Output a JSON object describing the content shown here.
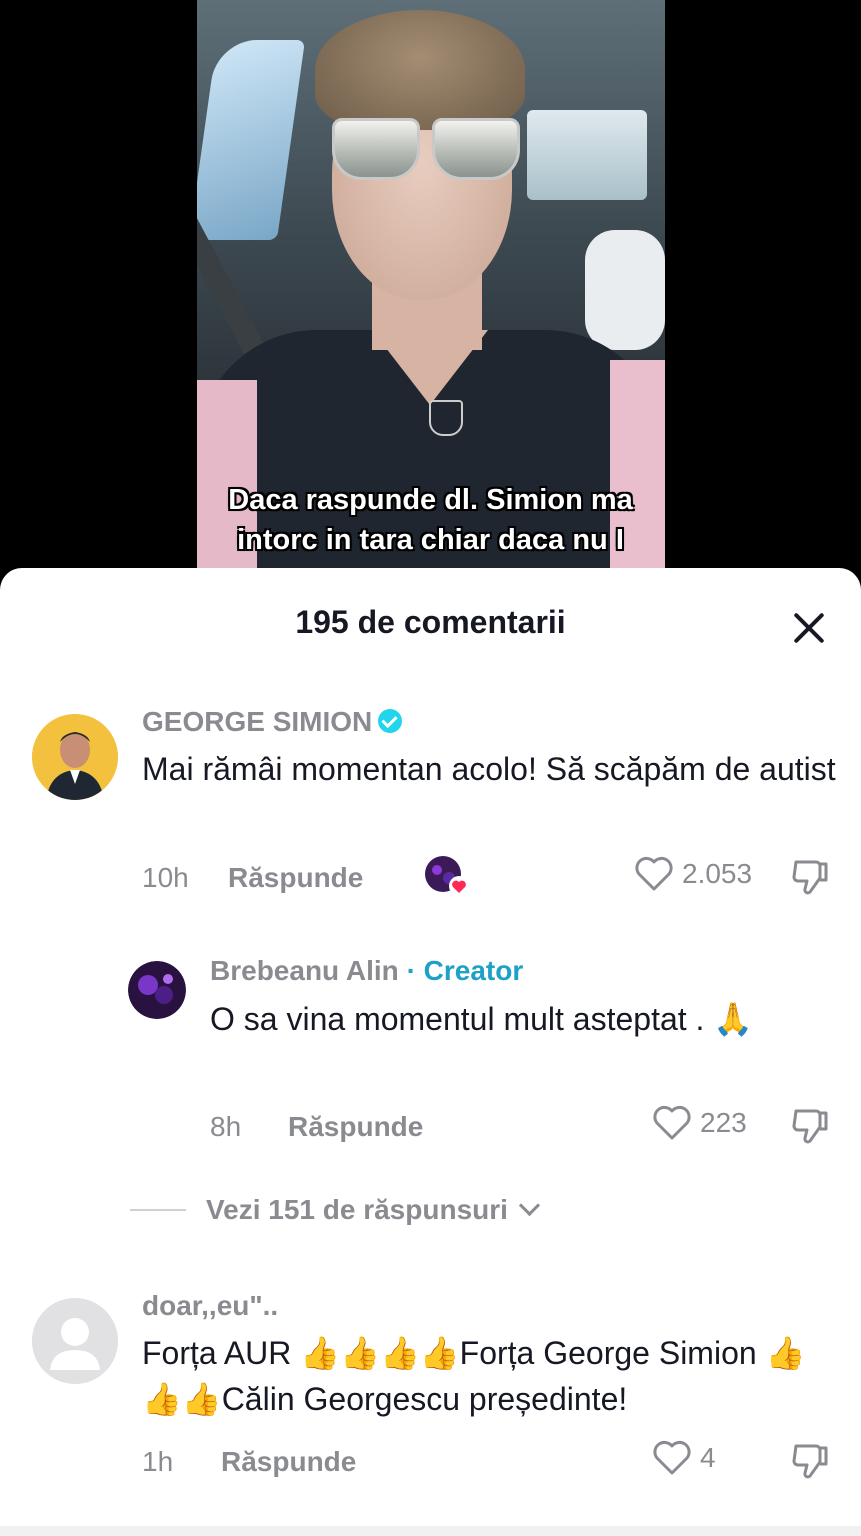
{
  "video": {
    "caption_lines": [
      "Daca raspunde dl. Simion ma",
      "intorc in tara chiar daca nu I"
    ]
  },
  "comments_panel": {
    "title": "195 de comentarii",
    "close_icon": "close-icon"
  },
  "comments": [
    {
      "author": "GEORGE SIMION",
      "verified": true,
      "text": "Mai rămâi momentan acolo! Să scăpăm de autist",
      "time": "10h",
      "reply_label": "Răspunde",
      "likes": "2.053",
      "creator_liked": true
    },
    {
      "author": "Brebeanu Alin",
      "author_tag": "· Creator",
      "text": "O sa vina momentul mult asteptat . 🙏",
      "time": "8h",
      "reply_label": "Răspunde",
      "likes": "223"
    },
    {
      "author": "doar,,eu\"..",
      "text": "Forța AUR 👍👍👍👍Forța George Simion 👍👍👍Călin Georgescu președinte!",
      "time": "1h",
      "reply_label": "Răspunde",
      "likes": "4"
    }
  ],
  "view_replies_label": "Vezi 151 de răspunsuri",
  "colors": {
    "creator_accent": "#1da1c6",
    "verified_badge": "#20d5ec",
    "like_heart": "#fe2c55",
    "muted_text": "#8a8b91"
  }
}
